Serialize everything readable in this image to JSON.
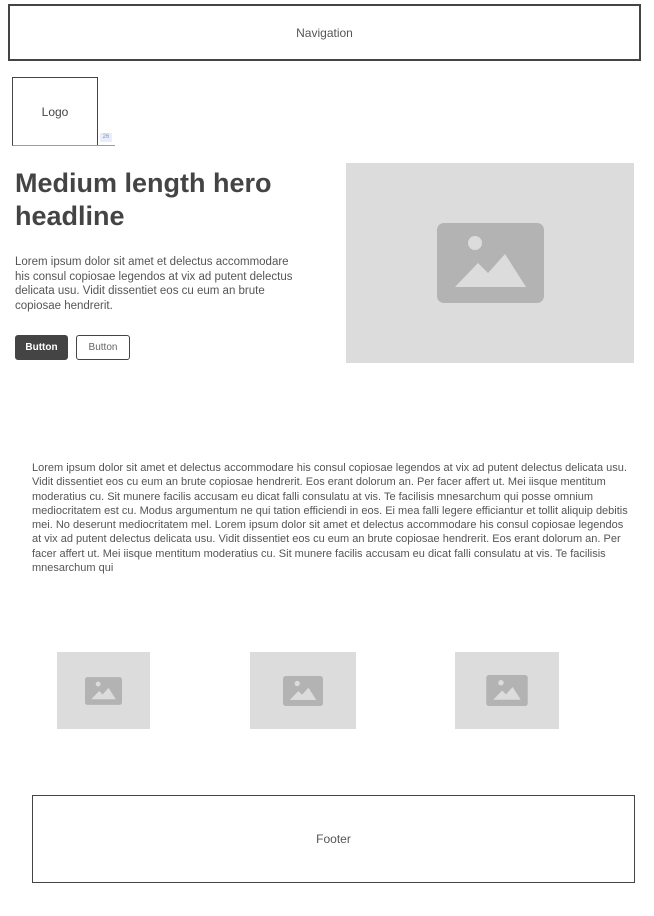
{
  "navigation": {
    "label": "Navigation"
  },
  "logo": {
    "label": "Logo",
    "badge": "26"
  },
  "hero": {
    "headline": "Medium length hero headline",
    "text": "Lorem ipsum dolor sit amet et delectus accommodare his consul copiosae legendos at vix ad putent delectus delicata usu. Vidit dissentiet eos cu eum an brute copiosae hendrerit.",
    "primary_button": "Button",
    "secondary_button": "Button",
    "image_icon": "image-icon"
  },
  "content": {
    "paragraph": "Lorem ipsum dolor sit amet et delectus accommodare his consul copiosae legendos at vix ad putent delectus delicata usu. Vidit dissentiet eos cu eum an brute copiosae hendrerit. Eos erant dolorum an. Per facer affert ut. Mei iisque mentitum moderatius cu. Sit munere facilis accusam eu dicat falli consulatu at vis. Te facilisis mnesarchum qui posse omnium mediocritatem est cu. Modus argumentum ne qui tation efficiendi in eos. Ei mea falli legere efficiantur et tollit aliquip debitis mei. No deserunt mediocritatem mel. Lorem ipsum dolor sit amet et delectus accommodare his consul copiosae legendos at vix ad putent delectus delicata usu. Vidit dissentiet eos cu eum an brute copiosae hendrerit. Eos erant dolorum an. Per facer affert ut. Mei iisque mentitum moderatius cu. Sit munere facilis accusam eu dicat falli consulatu at vis. Te facilisis mnesarchum qui"
  },
  "gallery": {
    "icon": "image-icon"
  },
  "footer": {
    "label": "Footer"
  },
  "colors": {
    "outline": "#444444",
    "placeholder_fill": "#dcdcdc",
    "placeholder_icon": "#b3b3b3",
    "primary_button": "#444444",
    "selection_accent": "#4bbfc9"
  }
}
